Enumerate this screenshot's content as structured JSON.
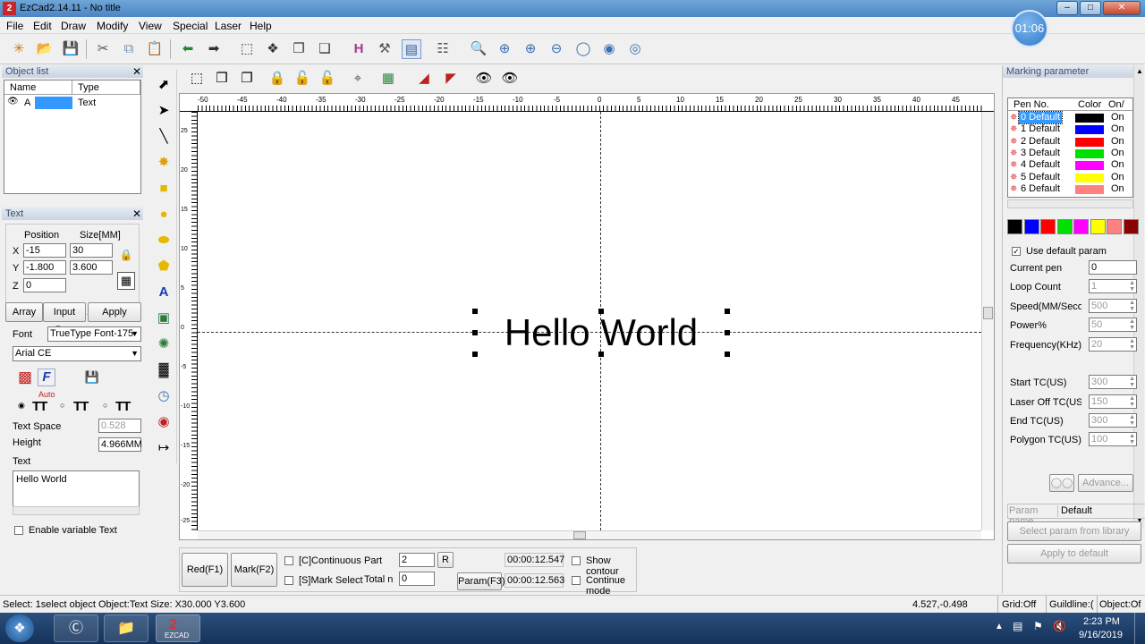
{
  "window": {
    "title": "EzCad2.14.11 - No title",
    "app_icon": "2",
    "timer": "01:06"
  },
  "menu": [
    "File",
    "Edit",
    "Draw",
    "Modify",
    "View",
    "Special",
    "Laser",
    "Help"
  ],
  "object_list": {
    "title": "Object list",
    "columns": [
      "Name",
      "Type"
    ],
    "rows": [
      {
        "name": "A",
        "type": "Text"
      }
    ]
  },
  "text_panel": {
    "title": "Text",
    "position_label": "Position",
    "size_label": "Size[MM]",
    "x_label": "X",
    "y_label": "Y",
    "z_label": "Z",
    "x": "-15",
    "y": "-1.800",
    "z": "0",
    "w": "30",
    "h": "3.600",
    "array_label": "Array",
    "input_port_label": "Input Port",
    "apply_label": "Apply",
    "font_label": "Font",
    "font_type": "TrueType Font-175",
    "font_name": "Arial CE",
    "auto_label": "Auto",
    "text_space_label": "Text Space",
    "text_space": "0.528",
    "height_label": "Height",
    "height": "4.966MM",
    "text_label": "Text",
    "text_value": "Hello World",
    "enable_variable_label": "Enable variable Text"
  },
  "canvas": {
    "text": "Hello World",
    "ruler_labels": [
      "-50",
      "-45",
      "-40",
      "-35",
      "-30",
      "-25",
      "-20",
      "-15",
      "-10",
      "-5",
      "0",
      "5",
      "10",
      "15",
      "20",
      "25",
      "30",
      "35",
      "40",
      "45"
    ],
    "v_ruler_labels": [
      "25",
      "20",
      "15",
      "10",
      "5",
      "0",
      "-5",
      "-10",
      "-15",
      "-20",
      "-25"
    ]
  },
  "bottom": {
    "red_label": "Red(F1)",
    "mark_label": "Mark(F2)",
    "continuous_label": "[C]Continuous",
    "mark_select_label": "[S]Mark Select",
    "part_label": "Part",
    "part_value": "2",
    "r_label": "R",
    "total_label": "Total n",
    "total_value": "0",
    "param_label": "Param(F3)",
    "time1": "00:00:12.547",
    "time2": "00:00:12.563",
    "show_contour_label": "Show contour",
    "continue_mode_label": "Continue mode"
  },
  "marking": {
    "title": "Marking parameter",
    "columns": [
      "Pen No.",
      "Color",
      "On/"
    ],
    "pens": [
      {
        "name": "0 Default",
        "color": "#000000",
        "on": "On"
      },
      {
        "name": "1 Default",
        "color": "#0000ff",
        "on": "On"
      },
      {
        "name": "2 Default",
        "color": "#ff0000",
        "on": "On"
      },
      {
        "name": "3 Default",
        "color": "#00e000",
        "on": "On"
      },
      {
        "name": "4 Default",
        "color": "#ff00ff",
        "on": "On"
      },
      {
        "name": "5 Default",
        "color": "#ffff00",
        "on": "On"
      },
      {
        "name": "6 Default",
        "color": "#ff8080",
        "on": "On"
      }
    ],
    "swatches": [
      "#000000",
      "#0000ff",
      "#ff0000",
      "#00e000",
      "#ff00ff",
      "#ffff00",
      "#ff8080",
      "#8b0000"
    ],
    "use_default_label": "Use default param",
    "params": [
      {
        "label": "Current pen",
        "value": "0"
      },
      {
        "label": "Loop Count",
        "value": "1"
      },
      {
        "label": "Speed(MM/Secon",
        "value": "500"
      },
      {
        "label": "Power%",
        "value": "50"
      },
      {
        "label": "Frequency(KHz)",
        "value": "20"
      },
      {
        "label": "Start TC(US)",
        "value": "300"
      },
      {
        "label": "Laser Off TC(US)",
        "value": "150"
      },
      {
        "label": "End TC(US)",
        "value": "300"
      },
      {
        "label": "Polygon TC(US)",
        "value": "100"
      }
    ],
    "advance_label": "Advance...",
    "param_name_label": "Param name",
    "param_name_value": "Default",
    "select_library_label": "Select param from library",
    "apply_default_label": "Apply to default"
  },
  "status": {
    "message": "Select: 1select object Object:Text Size: X30.000 Y3.600",
    "coords": "4.527,-0.498",
    "grid": "Grid:Off",
    "guideline": "Guildline:(",
    "object": "Object:Of"
  },
  "taskbar": {
    "time": "2:23 PM",
    "date": "9/16/2019",
    "ezcad_label": "EZCAD"
  }
}
